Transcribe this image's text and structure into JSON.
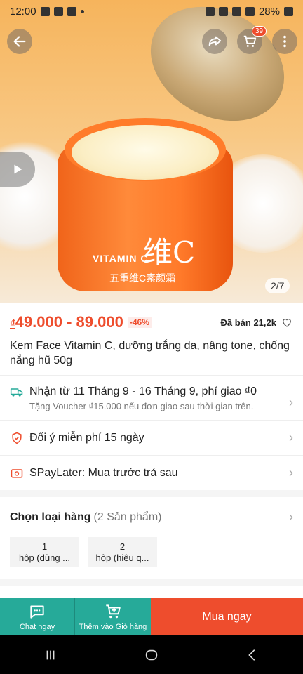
{
  "status_bar": {
    "time": "12:00",
    "battery": "28%"
  },
  "header": {
    "cart_count": "39"
  },
  "image": {
    "counter": "2/7",
    "jar_text_brand": "VITAMIN C",
    "jar_text_glyph": "维C",
    "jar_text_sub": "五重维C素颜霜"
  },
  "product": {
    "price_currency": "₫",
    "price_range": "49.000 - 89.000",
    "discount": "-46%",
    "sold": "Đã bán 21,2k",
    "title": "Kem Face Vitamin C, dưỡng trắng da, nâng tone, chống nắng hũ 50g"
  },
  "shipping": {
    "text": "Nhận từ 11 Tháng 9 - 16 Tháng 9, phí giao ₫0",
    "sub": "Tặng Voucher ₫15.000 nếu đơn giao sau thời gian trên."
  },
  "returns": {
    "text": "Đổi ý miễn phí 15 ngày"
  },
  "paylater": {
    "text": "SPayLater: Mua trước trả sau"
  },
  "variants": {
    "title": "Chọn loại hàng",
    "count": "(2 Sản phẩm)",
    "options": [
      {
        "line1": "1",
        "line2": "hộp (dùng ..."
      },
      {
        "line1": "2",
        "line2": "hộp (hiệu q..."
      }
    ]
  },
  "bottom_bar": {
    "chat_label": "Chat ngay",
    "add_cart_label": "Thêm vào Giỏ hàng",
    "buy_label": "Mua ngay"
  },
  "colors": {
    "accent": "#ee4d2d",
    "teal": "#26aa99"
  },
  "icons": [
    "back-arrow-icon",
    "share-icon",
    "cart-icon",
    "more-icon",
    "play-icon",
    "heart-icon",
    "truck-icon",
    "shield-icon",
    "paylater-icon",
    "chat-icon",
    "add-cart-icon"
  ]
}
